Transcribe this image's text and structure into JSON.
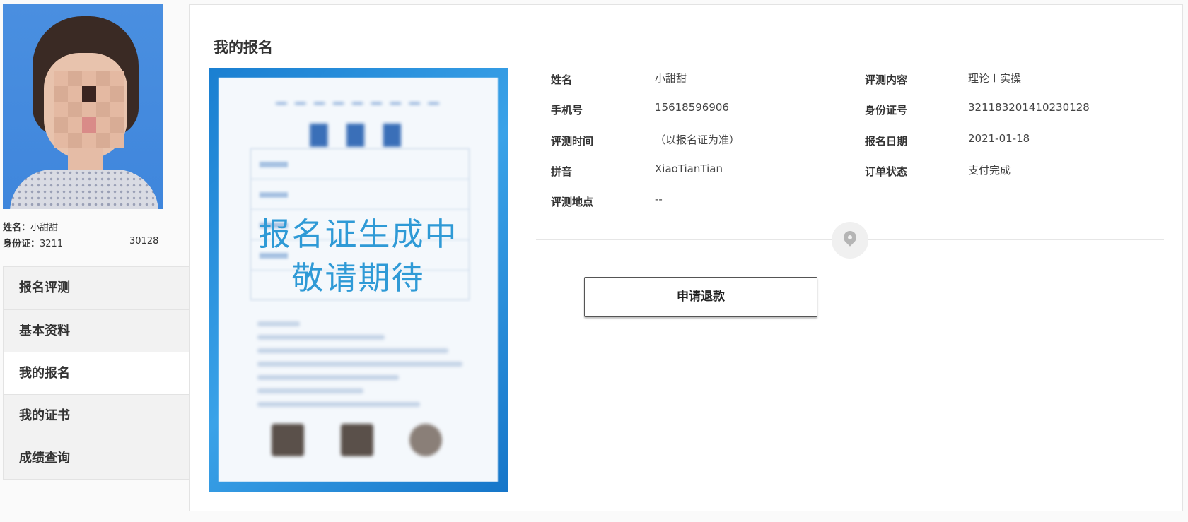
{
  "profile": {
    "name_label": "姓名：",
    "name_value": "小甜甜",
    "id_label": "身份证：",
    "id_value_start": "3211",
    "id_value_end": "30128"
  },
  "menu": {
    "items": [
      {
        "label": "报名评测"
      },
      {
        "label": "基本资料"
      },
      {
        "label": "我的报名"
      },
      {
        "label": "我的证书"
      },
      {
        "label": "成绩查询"
      }
    ],
    "active_index": 2
  },
  "panel": {
    "title": "我的报名",
    "certificate": {
      "overlay_line1": "报名证生成中",
      "overlay_line2": "敬请期待"
    },
    "info_left": [
      {
        "label": "姓名",
        "value": "小甜甜"
      },
      {
        "label": "手机号",
        "value": "15618596906"
      },
      {
        "label": "评测时间",
        "value": "（以报名证为准）"
      },
      {
        "label": "拼音",
        "value": "XiaoTianTian"
      },
      {
        "label": "评测地点",
        "value": "--"
      }
    ],
    "info_right": [
      {
        "label": "评测内容",
        "value": "理论＋实操"
      },
      {
        "label": "身份证号",
        "value": "321183201410230128"
      },
      {
        "label": "报名日期",
        "value": "2021-01-18"
      },
      {
        "label": "订单状态",
        "value": "支付完成"
      }
    ],
    "refund_button": "申请退款",
    "icons": {
      "divider": "location-pin-icon"
    }
  },
  "colors": {
    "cert_blue": "#1a7fd1",
    "overlay_text": "#2f9ad6",
    "menu_bg": "#f2f2f2"
  }
}
